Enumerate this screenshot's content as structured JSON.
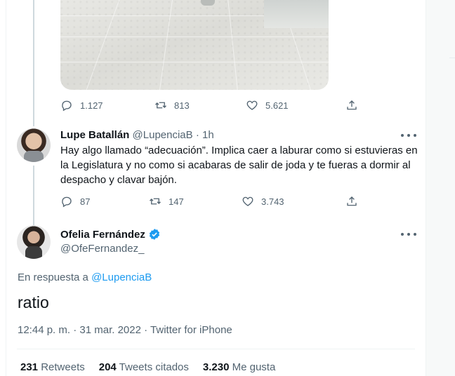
{
  "prev_tweet": {
    "stats": {
      "replies": "1.127",
      "retweets": "813",
      "likes": "5.621"
    }
  },
  "reply_tweet": {
    "author_name": "Lupe Batallán",
    "handle": "@LupenciaB",
    "separator": "·",
    "time": "1h",
    "text": "Hay algo llamado “adecuación”. Implica caer a laburar como si estuvieras en la Legislatura y no como si acabaras de salir de joda y te fueras a dormir al despacho y clavar bajón.",
    "stats": {
      "replies": "87",
      "retweets": "147",
      "likes": "3.743"
    }
  },
  "main_tweet": {
    "author_name": "Ofelia Fernández",
    "handle": "@OfeFernandez_",
    "reply_prefix": "En respuesta a",
    "reply_to": "@LupenciaB",
    "text": "ratio",
    "time": "12:44 p. m.",
    "dot": "·",
    "date": "31 mar. 2022",
    "source": "Twitter for iPhone",
    "retweets_count": "231",
    "retweets_label": "Retweets",
    "quotes_count": "204",
    "quotes_label": "Tweets citados",
    "likes_count": "3.230",
    "likes_label": "Me gusta"
  },
  "colors": {
    "accent": "#1d9bf0",
    "text": "#0f1419",
    "muted": "#536471",
    "border": "#eff3f4",
    "thread": "#cfd9de"
  },
  "icons": [
    "reply-icon",
    "retweet-icon",
    "like-icon",
    "share-icon",
    "more-icon",
    "verified-badge-icon"
  ]
}
